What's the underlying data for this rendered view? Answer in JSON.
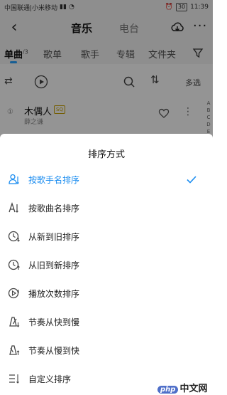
{
  "statusbar": {
    "carrier": "中国联通|小米移动",
    "battery": "30",
    "time": "11:39"
  },
  "topbar": {
    "active_title": "音乐",
    "inactive_title": "电台",
    "back_icon": "back-arrow-icon",
    "cloud_icon": "cloud-download-icon",
    "more_icon": "more-dots-icon"
  },
  "tabs": [
    {
      "label": "单曲",
      "count": "/3",
      "active": true
    },
    {
      "label": "歌单"
    },
    {
      "label": "歌手"
    },
    {
      "label": "专辑"
    },
    {
      "label": "文件夹"
    }
  ],
  "toolbar": {
    "multi_select": "多选"
  },
  "song": {
    "name": "木偶人",
    "badge": "SQ",
    "artist": "薛之谦"
  },
  "index_letters": [
    "A",
    "B",
    "C",
    "D",
    "E"
  ],
  "sort_sheet": {
    "title": "排序方式",
    "accent_color": "#1a8cf0",
    "options": [
      {
        "label": "按歌手名排序",
        "icon": "person-sort-icon",
        "selected": true
      },
      {
        "label": "按歌曲名排序",
        "icon": "letter-sort-icon",
        "selected": false
      },
      {
        "label": "从新到旧排序",
        "icon": "clock-new-icon",
        "selected": false
      },
      {
        "label": "从旧到新排序",
        "icon": "clock-old-icon",
        "selected": false
      },
      {
        "label": "播放次数排序",
        "icon": "play-count-icon",
        "selected": false
      },
      {
        "label": "节奏从快到慢",
        "icon": "metronome-fast-icon",
        "selected": false
      },
      {
        "label": "节奏从慢到快",
        "icon": "metronome-slow-icon",
        "selected": false
      },
      {
        "label": "自定义排序",
        "icon": "custom-list-icon",
        "selected": false
      }
    ]
  },
  "watermark": {
    "brand": "php",
    "site": "中文网"
  }
}
